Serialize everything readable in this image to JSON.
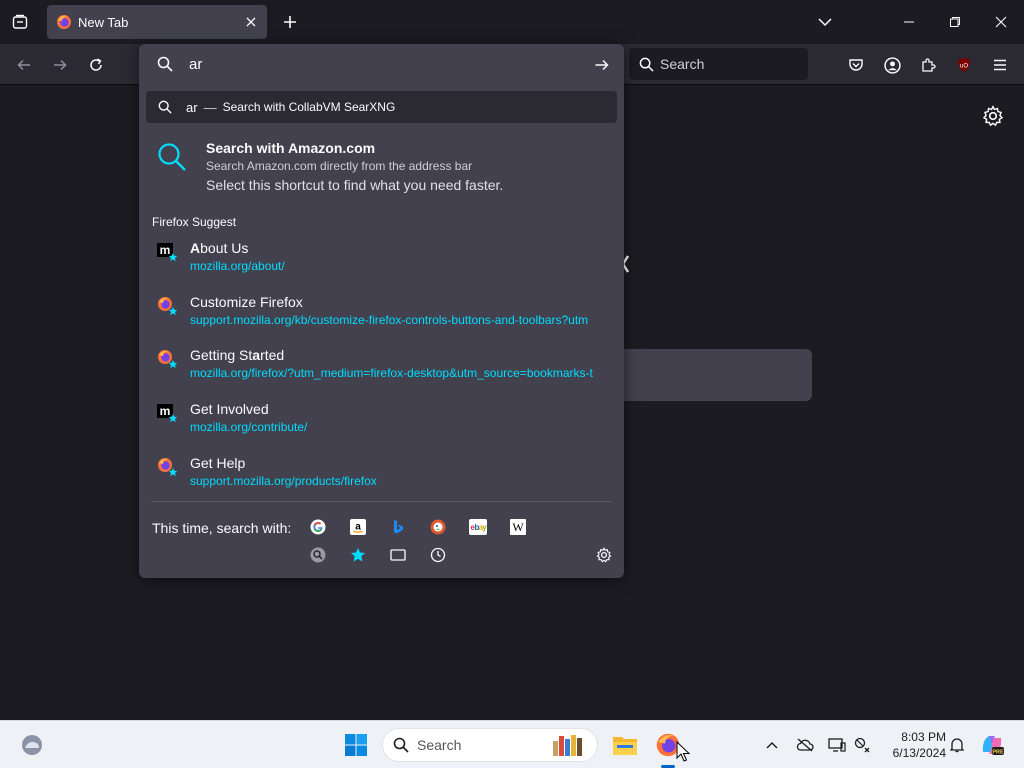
{
  "tab": {
    "title": "New Tab"
  },
  "navbar": {
    "search_placeholder": "Search"
  },
  "urlbar": {
    "value": "ar",
    "heuristic": {
      "query": "ar",
      "separator": "—",
      "action": "Search with CollabVM SearXNG"
    },
    "tip": {
      "title": "Search with Amazon.com",
      "subtitle": "Search Amazon.com directly from the address bar",
      "description": "Select this shortcut to find what you need faster."
    },
    "group_label": "Firefox Suggest",
    "suggestions": [
      {
        "name_bold": "A",
        "name_rest": "bout Us",
        "url": "mozilla.org/about/",
        "icon": "mozilla-m-icon"
      },
      {
        "name": "Customize Firefox",
        "url": "support.mozilla.org/kb/customize-firefox-controls-buttons-and-toolbars?utm",
        "icon": "firefox-icon"
      },
      {
        "name_pre": "Getting St",
        "name_bold": "a",
        "name_post": "rted",
        "url": "mozilla.org/firefox/?utm_medium=firefox-desktop&utm_source=bookmarks-t",
        "icon": "firefox-icon"
      },
      {
        "name": "Get Involved",
        "url": "mozilla.org/contribute/",
        "icon": "mozilla-m-icon"
      },
      {
        "name": "Get Help",
        "url": "support.mozilla.org/products/firefox",
        "icon": "firefox-icon"
      }
    ],
    "oneoff_label": "This time, search with:",
    "engines": [
      "google-icon",
      "amazon-icon",
      "bing-icon",
      "duckduckgo-icon",
      "ebay-icon",
      "wikipedia-icon",
      "searxng-icon",
      "bookmarks-icon",
      "tabs-icon",
      "history-icon"
    ]
  },
  "taskbar": {
    "search_placeholder": "Search",
    "time": "8:03 PM",
    "date": "6/13/2024"
  },
  "colors": {
    "accent_url": "#00ddff",
    "panel": "#42414d",
    "toolbar": "#2b2a33",
    "background": "#1c1b22"
  }
}
